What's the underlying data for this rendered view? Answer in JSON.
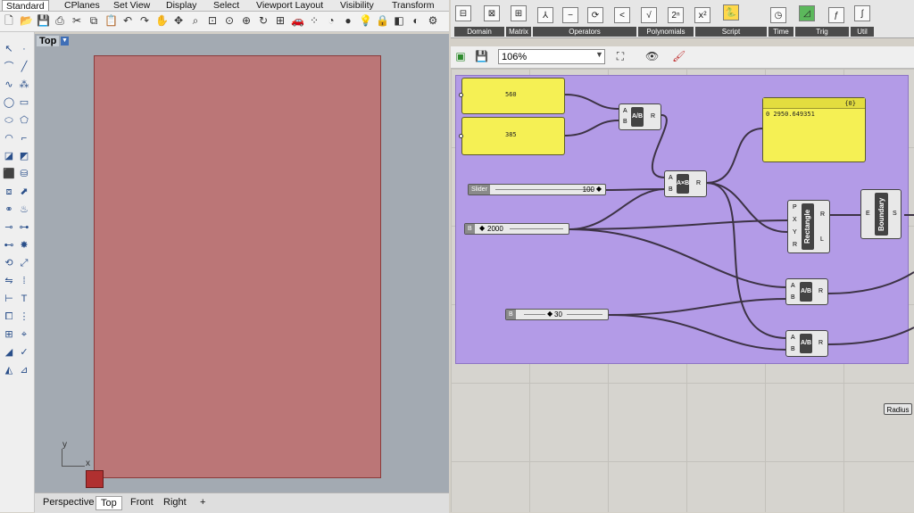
{
  "rhino": {
    "menu_tabs": [
      "Standard",
      "CPlanes",
      "Set View",
      "Display",
      "Select",
      "Viewport Layout",
      "Visibility",
      "Transform"
    ],
    "active_tab": "Standard",
    "viewport": {
      "label": "Top",
      "axis_x": "x",
      "axis_y": "y"
    },
    "view_tabs": [
      "Perspective",
      "Top",
      "Front",
      "Right"
    ],
    "active_view": "Top",
    "add_view": "+",
    "rect_color": "#bb7677"
  },
  "grasshopper": {
    "ribbon_sections": [
      "Domain",
      "Matrix",
      "Operators",
      "Polynomials",
      "Script",
      "Time",
      "Trig",
      "Util"
    ],
    "ribbon_icons": [
      "ⅹ²",
      "√",
      "2ⁿ",
      "⇌",
      "<",
      "=",
      "?"
    ],
    "zoom": "106%",
    "panels": {
      "p1": "560",
      "p2": "385",
      "output_index": "{0}",
      "output_value": "0 2950.649351"
    },
    "components": {
      "div1": {
        "label": "A/B",
        "inputs": [
          "A",
          "B"
        ],
        "output": "R"
      },
      "mul": {
        "label": "A×B",
        "inputs": [
          "A",
          "B"
        ],
        "output": "R"
      },
      "rect": {
        "label": "Rectangle",
        "inputs": [
          "P",
          "X",
          "Y",
          "R"
        ],
        "outputs": [
          "R",
          "L"
        ]
      },
      "boundary": {
        "label": "Boundary",
        "inputs": [
          "E"
        ],
        "output": "S"
      },
      "div2": {
        "label": "A/B",
        "inputs": [
          "A",
          "B"
        ],
        "output": "R"
      },
      "div3": {
        "label": "A/B",
        "inputs": [
          "A",
          "B"
        ],
        "output": "R"
      }
    },
    "sliders": {
      "s1": {
        "tag": "Slider",
        "value": "100"
      },
      "s2": {
        "tag": "B",
        "value": "2000"
      },
      "s3": {
        "tag": "B",
        "value": "30"
      }
    },
    "radius_button": "Radius",
    "group_color": "#b39be7"
  }
}
